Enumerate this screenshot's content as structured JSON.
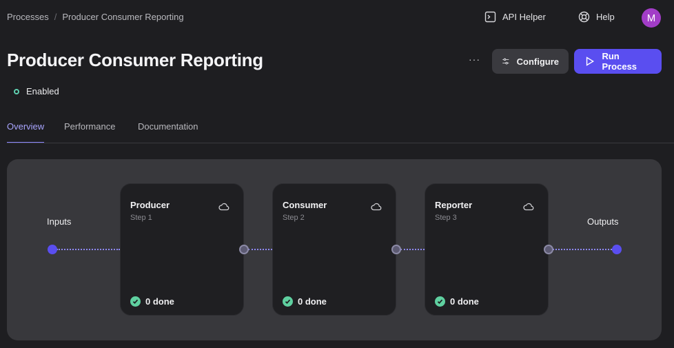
{
  "breadcrumb": {
    "root": "Processes",
    "separator": "/",
    "current": "Producer Consumer Reporting"
  },
  "topnav": {
    "api_helper": "API Helper",
    "help": "Help",
    "avatar_initial": "M"
  },
  "header": {
    "title": "Producer Consumer Reporting",
    "more": "···",
    "configure": "Configure",
    "run": "Run Process"
  },
  "status": {
    "label": "Enabled"
  },
  "tabs": [
    {
      "label": "Overview",
      "active": true
    },
    {
      "label": "Performance",
      "active": false
    },
    {
      "label": "Documentation",
      "active": false
    }
  ],
  "flow": {
    "inputs_label": "Inputs",
    "outputs_label": "Outputs",
    "nodes": [
      {
        "name": "Producer",
        "step": "Step 1",
        "done": "0 done"
      },
      {
        "name": "Consumer",
        "step": "Step 2",
        "done": "0 done"
      },
      {
        "name": "Reporter",
        "step": "Step 3",
        "done": "0 done"
      }
    ]
  },
  "colors": {
    "accent": "#5a4ef0",
    "success": "#5fd0a0",
    "avatar": "#a23dc7",
    "background": "#1e1e21",
    "canvas": "#38383c"
  }
}
